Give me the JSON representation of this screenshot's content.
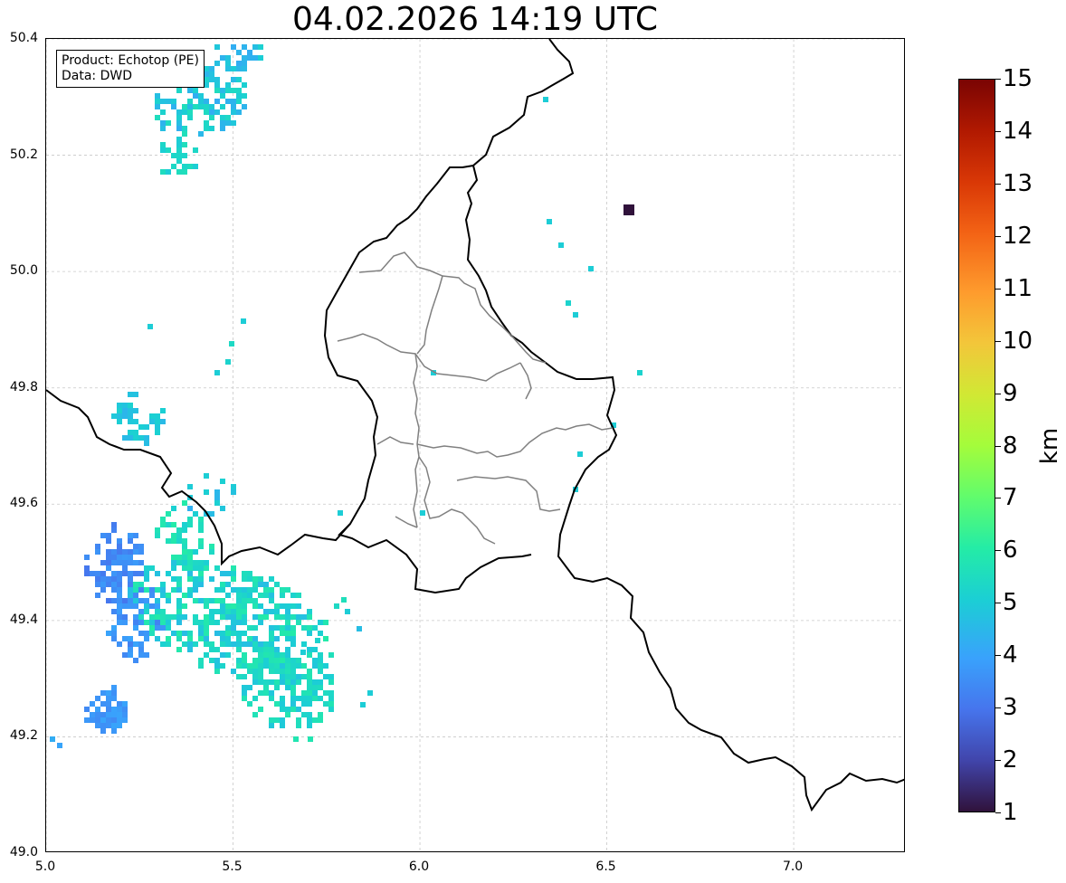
{
  "title": "04.02.2026 14:19 UTC",
  "info": {
    "product": "Product: Echotop (PE)",
    "data": "Data: DWD"
  },
  "axes": {
    "xlim": [
      5.0,
      7.3
    ],
    "ylim": [
      49.0,
      50.4
    ],
    "xticks": [
      "5.0",
      "5.5",
      "6.0",
      "6.5",
      "7.0"
    ],
    "yticks": [
      "49.0",
      "49.2",
      "49.4",
      "49.6",
      "49.8",
      "50.0",
      "50.2",
      "50.4"
    ],
    "grid": true
  },
  "colorbar": {
    "label": "km",
    "ticks": [
      "1",
      "2",
      "3",
      "4",
      "5",
      "6",
      "7",
      "8",
      "9",
      "10",
      "11",
      "12",
      "13",
      "14",
      "15"
    ],
    "range": [
      1,
      15
    ],
    "colormap": "turbo"
  },
  "colors": {
    "low": "#30123b",
    "blue": "#3e9bfe",
    "cyan": "#18d7cb",
    "green": "#46f884",
    "yellow": "#e1dd37",
    "orange": "#f65f18",
    "high": "#7a0403"
  },
  "echo_areas": [
    {
      "name": "north-west cluster",
      "lon": [
        5.25,
        5.45
      ],
      "lat": [
        50.2,
        50.4
      ],
      "top_km": [
        4,
        6
      ]
    },
    {
      "name": "south-west main band",
      "lon": [
        5.05,
        5.7
      ],
      "lat": [
        49.2,
        49.65
      ],
      "top_km": [
        3,
        6
      ]
    },
    {
      "name": "isolated cell",
      "lon": [
        6.54,
        6.56
      ],
      "lat": [
        50.1,
        50.12
      ],
      "top_km": [
        1,
        1
      ]
    }
  ]
}
